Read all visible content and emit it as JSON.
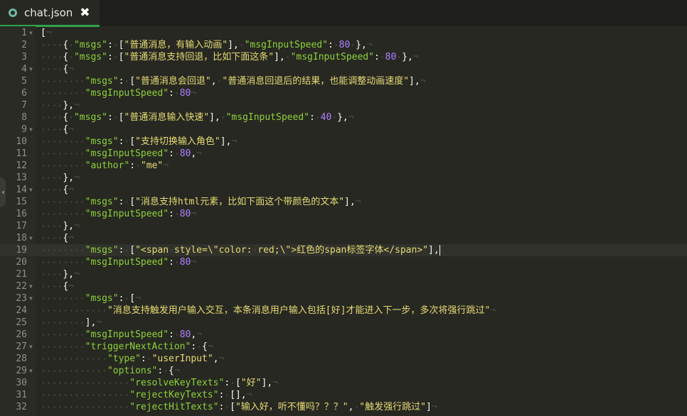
{
  "tab": {
    "title": "chat.json",
    "close": "✖"
  },
  "editor": {
    "active_line": 19,
    "fold_lines": [
      1,
      4,
      9,
      14,
      18,
      22,
      23,
      27,
      29
    ],
    "lines": [
      "[",
      "    { \"msgs\": [\"普通消息，有输入动画\"], \"msgInputSpeed\": 80 },",
      "    { \"msgs\": [\"普通消息支持回退，比如下面这条\"], \"msgInputSpeed\": 80 },",
      "    {",
      "        \"msgs\": [\"普通消息会回退\", \"普通消息回退后的结果，也能调整动画速度\"],",
      "        \"msgInputSpeed\": 80",
      "    },",
      "    { \"msgs\": [\"普通消息输入快速\"], \"msgInputSpeed\": 40 },",
      "    {",
      "        \"msgs\": [\"支持切换输入角色\"],",
      "        \"msgInputSpeed\": 80,",
      "        \"author\": \"me\"",
      "    },",
      "    {",
      "        \"msgs\": [\"消息支持html元素，比如下面这个带颜色的文本\"],",
      "        \"msgInputSpeed\": 80",
      "    },",
      "    {",
      "        \"msgs\": [\"<span style=\\\"color: red;\\\">红色的span标签字体</span>\"],",
      "        \"msgInputSpeed\": 80",
      "    },",
      "    {",
      "        \"msgs\": [",
      "            \"消息支持触发用户输入交互，本条消息用户输入包括[好]才能进入下一步，多次将强行跳过\"",
      "        ],",
      "        \"msgInputSpeed\": 80,",
      "        \"triggerNextAction\": {",
      "            \"type\": \"userInput\",",
      "            \"options\": {",
      "                \"resolveKeyTexts\": [\"好\"],",
      "                \"rejectKeyTexts\": [],",
      "                \"rejectHitTexts\": [\"输入好，听不懂吗？？？\", \"触发强行跳过\"]"
    ]
  }
}
